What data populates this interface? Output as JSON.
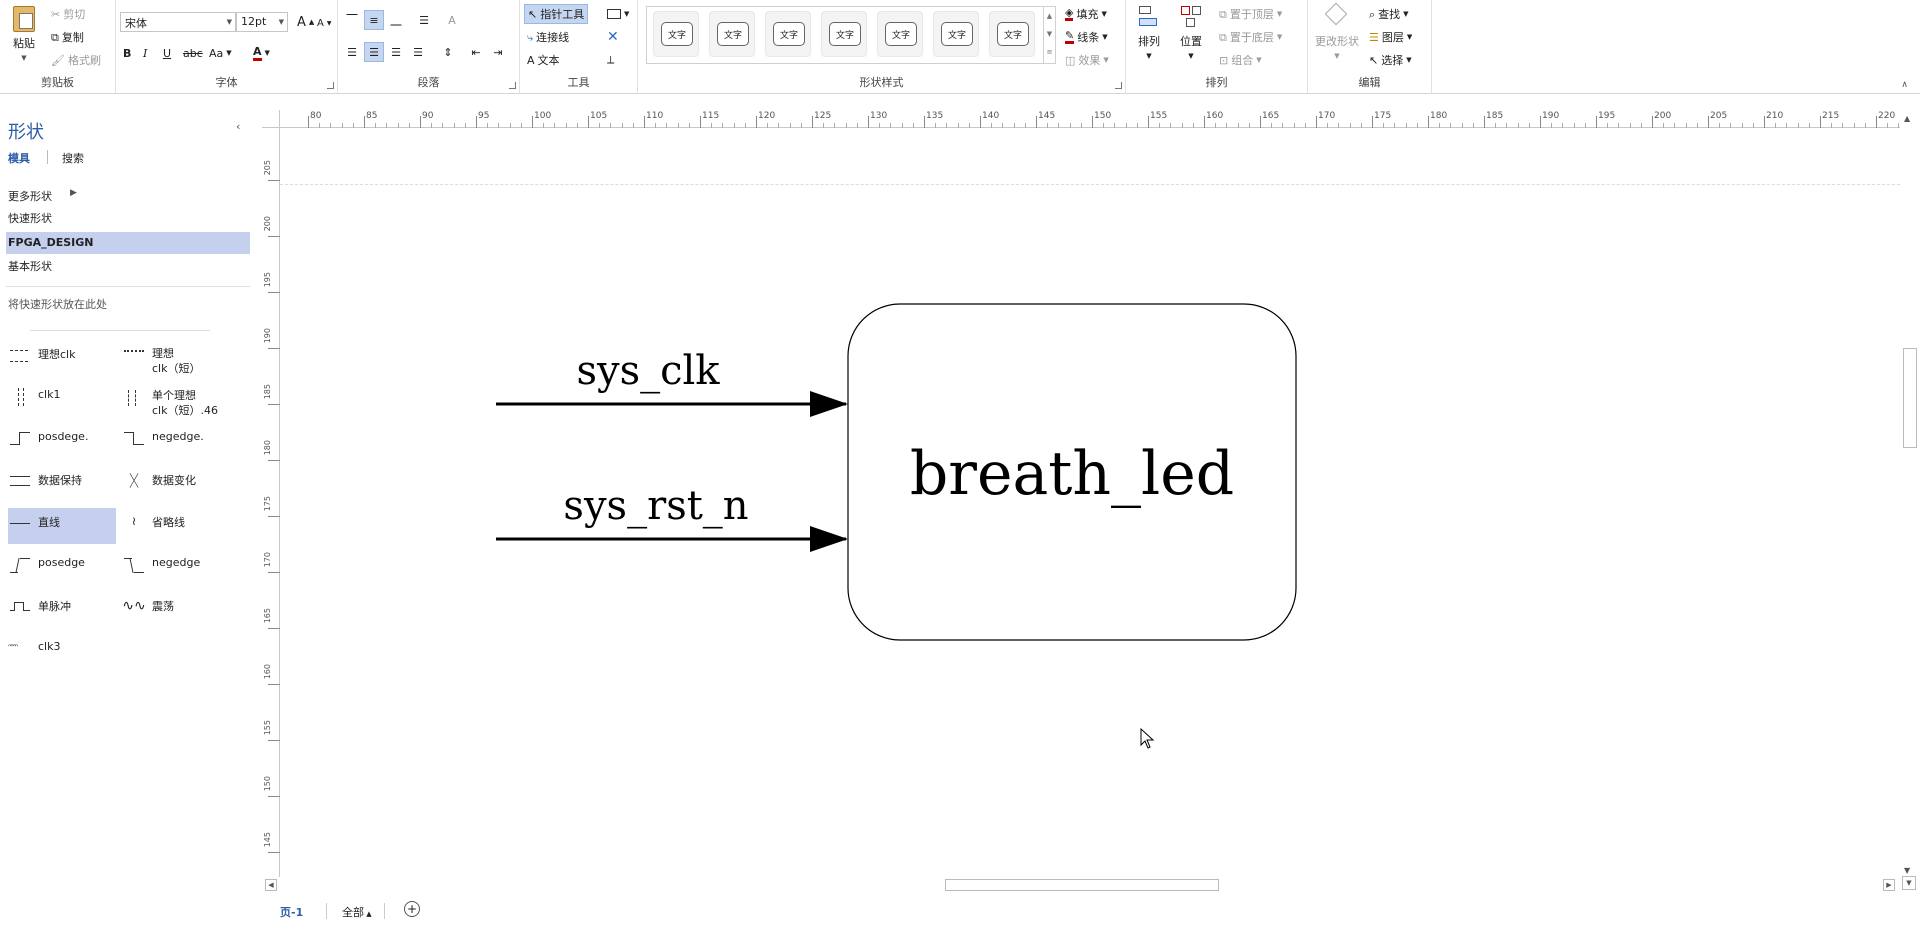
{
  "ribbon": {
    "clipboard": {
      "label": "剪贴板",
      "paste": "粘贴",
      "cut": "剪切",
      "copy": "复制",
      "format_painter": "格式刷"
    },
    "font": {
      "label": "字体",
      "name": "宋体",
      "size": "12pt",
      "bold": "B",
      "italic": "I",
      "underline": "U",
      "strike": "abc",
      "case": "Aa",
      "color": "A",
      "grow": "A",
      "shrink": "A"
    },
    "paragraph": {
      "label": "段落"
    },
    "tools": {
      "label": "工具",
      "pointer": "指针工具",
      "connector": "连接线",
      "text": "文本"
    },
    "shape_styles": {
      "label": "形状样式",
      "swatches": [
        "文字",
        "文字",
        "文字",
        "文字",
        "文字",
        "文字",
        "文字"
      ],
      "fill": "填充",
      "line": "线条",
      "effects": "效果"
    },
    "arrange": {
      "label": "排列",
      "align": "排列",
      "position": "位置",
      "bring_front": "置于顶层",
      "send_back": "置于底层",
      "group": "组合"
    },
    "editing": {
      "label": "编辑",
      "change_shape": "更改形状",
      "find": "查找",
      "layers": "图层",
      "select": "选择"
    }
  },
  "panel": {
    "title": "形状",
    "tab_stencils": "模具",
    "tab_search": "搜索",
    "items": [
      "更多形状",
      "快速形状",
      "FPGA_DESIGN",
      "基本形状"
    ],
    "hint": "将快速形状放在此处",
    "shapes": [
      {
        "label": "理想clk"
      },
      {
        "label": "理想\nclk（短）"
      },
      {
        "label": "clk1"
      },
      {
        "label": "单个理想\nclk（短）.46"
      },
      {
        "label": "posdege."
      },
      {
        "label": "negedge."
      },
      {
        "label": "数据保持"
      },
      {
        "label": "数据变化"
      },
      {
        "label": "直线"
      },
      {
        "label": "省略线"
      },
      {
        "label": "posedge"
      },
      {
        "label": "negedge"
      },
      {
        "label": "单脉冲"
      },
      {
        "label": "震荡"
      },
      {
        "label": "clk3"
      }
    ]
  },
  "ruler": {
    "h_ticks": [
      "80",
      "85",
      "90",
      "95",
      "100",
      "105",
      "110",
      "115",
      "120",
      "125",
      "130",
      "135",
      "140",
      "145",
      "150",
      "155",
      "160",
      "165",
      "170",
      "175",
      "180",
      "185",
      "190",
      "195",
      "200",
      "205",
      "210",
      "215",
      "220"
    ],
    "v_ticks": [
      "205",
      "200",
      "195",
      "190",
      "185",
      "180",
      "175",
      "170",
      "165",
      "160",
      "155",
      "150",
      "145"
    ]
  },
  "diagram": {
    "block_label": "breath_led",
    "inputs": [
      "sys_clk",
      "sys_rst_n"
    ]
  },
  "tabs": {
    "page": "页-1",
    "all": "全部"
  }
}
